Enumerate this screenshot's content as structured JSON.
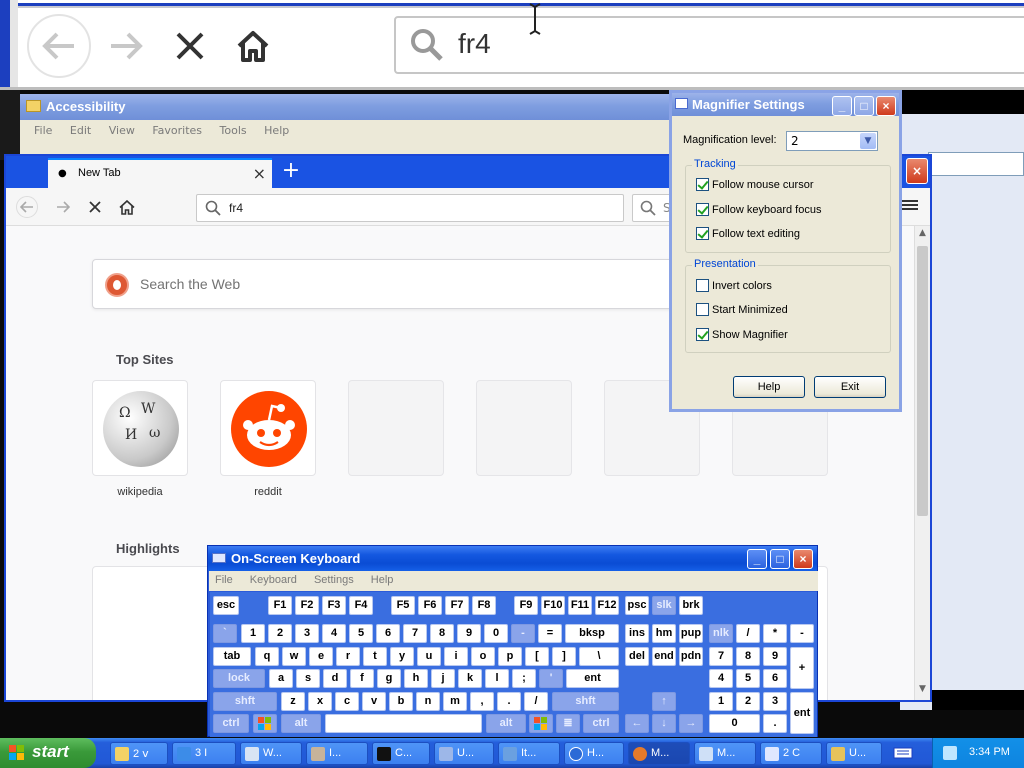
{
  "magnifier": {
    "search_text": "fr4"
  },
  "accessibility_window": {
    "title": "Accessibility",
    "menu": [
      "File",
      "Edit",
      "View",
      "Favorites",
      "Tools",
      "Help"
    ]
  },
  "firefox": {
    "tab_title": "New Tab",
    "url_text": "fr4",
    "search_placeholder": "S",
    "search_box_placeholder": "Search the Web",
    "top_sites_heading": "Top Sites",
    "highlights_heading": "Highlights",
    "top_sites": [
      {
        "label": "wikipedia"
      },
      {
        "label": "reddit"
      },
      {
        "label": ""
      },
      {
        "label": ""
      },
      {
        "label": ""
      },
      {
        "label": ""
      }
    ]
  },
  "magnifier_settings": {
    "title": "Magnifier Settings",
    "magnification_label": "Magnification level:",
    "magnification_value": "2",
    "tracking_heading": "Tracking",
    "tracking": [
      {
        "label": "Follow mouse cursor",
        "checked": true
      },
      {
        "label": "Follow keyboard focus",
        "checked": true
      },
      {
        "label": "Follow text editing",
        "checked": true
      }
    ],
    "presentation_heading": "Presentation",
    "presentation": [
      {
        "label": "Invert colors",
        "checked": false
      },
      {
        "label": "Start Minimized",
        "checked": false
      },
      {
        "label": "Show Magnifier",
        "checked": true
      }
    ],
    "help_label": "Help",
    "exit_label": "Exit"
  },
  "osk": {
    "title": "On-Screen Keyboard",
    "menu": [
      "File",
      "Keyboard",
      "Settings",
      "Help"
    ],
    "keys": {
      "esc": "esc",
      "f1": "F1",
      "f2": "F2",
      "f3": "F3",
      "f4": "F4",
      "f5": "F5",
      "f6": "F6",
      "f7": "F7",
      "f8": "F8",
      "f9": "F9",
      "f10": "F10",
      "f11": "F11",
      "f12": "F12",
      "psc": "psc",
      "slk": "slk",
      "brk": "brk",
      "backtick": "`",
      "n1": "1",
      "n2": "2",
      "n3": "3",
      "n4": "4",
      "n5": "5",
      "n6": "6",
      "n7": "7",
      "n8": "8",
      "n9": "9",
      "n0": "0",
      "minus": "-",
      "equals": "=",
      "bksp": "bksp",
      "ins": "ins",
      "hm": "hm",
      "pup": "pup",
      "nlk": "nlk",
      "kp_div": "/",
      "kp_mul": "*",
      "kp_sub": "-",
      "tab": "tab",
      "q": "q",
      "w": "w",
      "e": "e",
      "r": "r",
      "t": "t",
      "y": "y",
      "u": "u",
      "i": "i",
      "o": "o",
      "p": "p",
      "lbr": "[",
      "rbr": "]",
      "bslash": "\\",
      "del": "del",
      "end": "end",
      "pdn": "pdn",
      "kp7": "7",
      "kp8": "8",
      "kp9": "9",
      "kp_add": "+",
      "lock": "lock",
      "a": "a",
      "s": "s",
      "d": "d",
      "f": "f",
      "g": "g",
      "h": "h",
      "j": "j",
      "k": "k",
      "l": "l",
      "semi": ";",
      "quote": "'",
      "ent": "ent",
      "kp4": "4",
      "kp5": "5",
      "kp6": "6",
      "lshft": "shft",
      "z": "z",
      "x": "x",
      "c": "c",
      "v": "v",
      "b": "b",
      "n": "n",
      "m": "m",
      "comma": ",",
      "period": ".",
      "slash": "/",
      "rshft": "shft",
      "up": "↑",
      "kp1": "1",
      "kp2": "2",
      "kp3": "3",
      "kp_ent": "ent",
      "lctrl": "ctrl",
      "lalt": "alt",
      "space": "",
      "ralt": "alt",
      "rctrl": "ctrl",
      "left": "←",
      "down": "↓",
      "right": "→",
      "kp0": "0",
      "kp_dot": "."
    }
  },
  "taskbar": {
    "start_label": "start",
    "items": [
      {
        "label": "2 ⅴ",
        "icon": "folder-icon"
      },
      {
        "label": "3 I",
        "icon": "ie-icon"
      },
      {
        "label": "W...",
        "icon": "media-icon"
      },
      {
        "label": "I...",
        "icon": "accessibility-icon"
      },
      {
        "label": "C...",
        "icon": "cmd-icon"
      },
      {
        "label": "U...",
        "icon": "utility-icon"
      },
      {
        "label": "It...",
        "icon": "shield-icon"
      },
      {
        "label": "H...",
        "icon": "help-icon"
      },
      {
        "label": "M...",
        "icon": "firefox-icon"
      },
      {
        "label": "M...",
        "icon": "magnifier-icon"
      },
      {
        "label": "2 C",
        "icon": "osk-icon"
      },
      {
        "label": "U...",
        "icon": "install-icon"
      }
    ],
    "clock": "3:34 PM"
  },
  "colors": {
    "xp_blue": "#245edb",
    "start_green": "#3a9a3a",
    "ddg_orange": "#de5833",
    "reddit_orange": "#ff4500",
    "checkbox_green": "#21a121"
  }
}
